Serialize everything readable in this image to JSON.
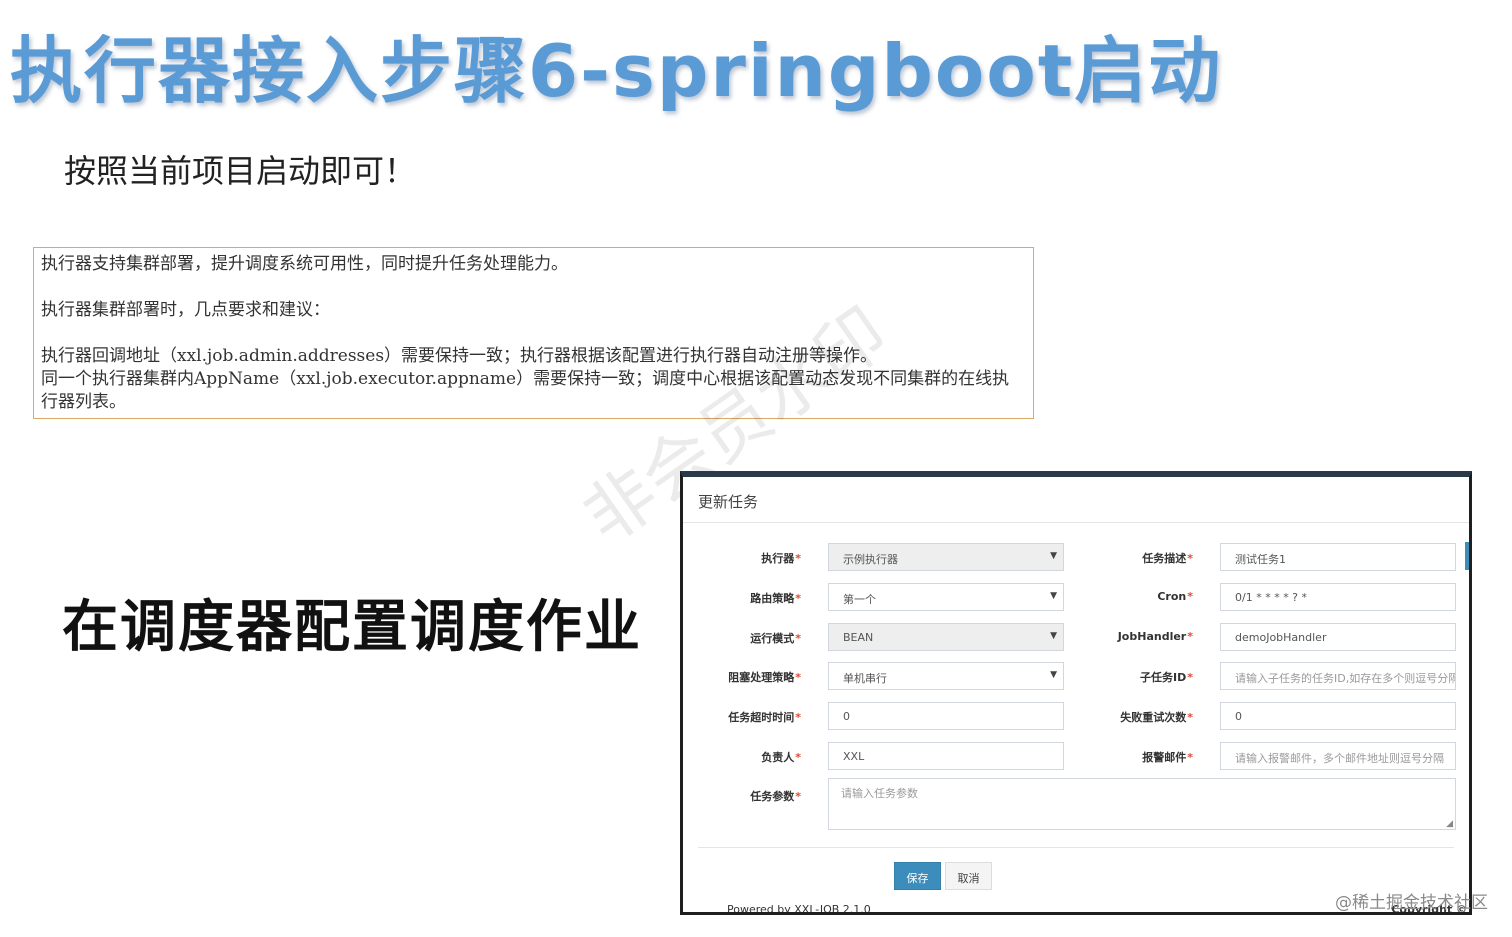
{
  "slide": {
    "title": "执行器接入步骤6-springboot启动",
    "subtitle": "按照当前项目启动即可！",
    "notice": {
      "line1": "执行器支持集群部署，提升调度系统可用性，同时提升任务处理能力。",
      "line2": "执行器集群部署时，几点要求和建议：",
      "line3": "执行器回调地址（xxl.job.admin.addresses）需要保持一致；执行器根据该配置进行执行器自动注册等操作。",
      "line4": "同一个执行器集群内AppName（xxl.job.executor.appname）需要保持一致；调度中心根据该配置动态发现不同集群的在线执行器列表。"
    },
    "heading": "在调度器配置调度作业",
    "watermark": "非会员水印",
    "corner_mark": "@稀土掘金技术社区"
  },
  "modal": {
    "title": "更新任务",
    "fields": {
      "executor": {
        "label": "执行器",
        "value": "示例执行器"
      },
      "job_desc": {
        "label": "任务描述",
        "value": "测试任务1"
      },
      "route_strategy": {
        "label": "路由策略",
        "value": "第一个"
      },
      "cron": {
        "label": "Cron",
        "value": "0/1 * * * * ? *"
      },
      "run_mode": {
        "label": "运行模式",
        "value": "BEAN"
      },
      "job_handler": {
        "label": "JobHandler",
        "value": "demoJobHandler"
      },
      "block_strategy": {
        "label": "阻塞处理策略",
        "value": "单机串行"
      },
      "child_job_id": {
        "label": "子任务ID",
        "placeholder": "请输入子任务的任务ID,如存在多个则逗号分隔"
      },
      "timeout": {
        "label": "任务超时时间",
        "value": "0"
      },
      "fail_retry": {
        "label": "失败重试次数",
        "value": "0"
      },
      "author": {
        "label": "负责人",
        "value": "XXL"
      },
      "alarm_email": {
        "label": "报警邮件",
        "placeholder": "请输入报警邮件，多个邮件地址则逗号分隔"
      },
      "job_param": {
        "label": "任务参数",
        "placeholder": "请输入任务参数"
      }
    },
    "buttons": {
      "save": "保存",
      "cancel": "取消"
    },
    "background_footer_left": "Powered by XXL-JOB 2.1.0",
    "background_footer_right": "Copyright ©"
  }
}
